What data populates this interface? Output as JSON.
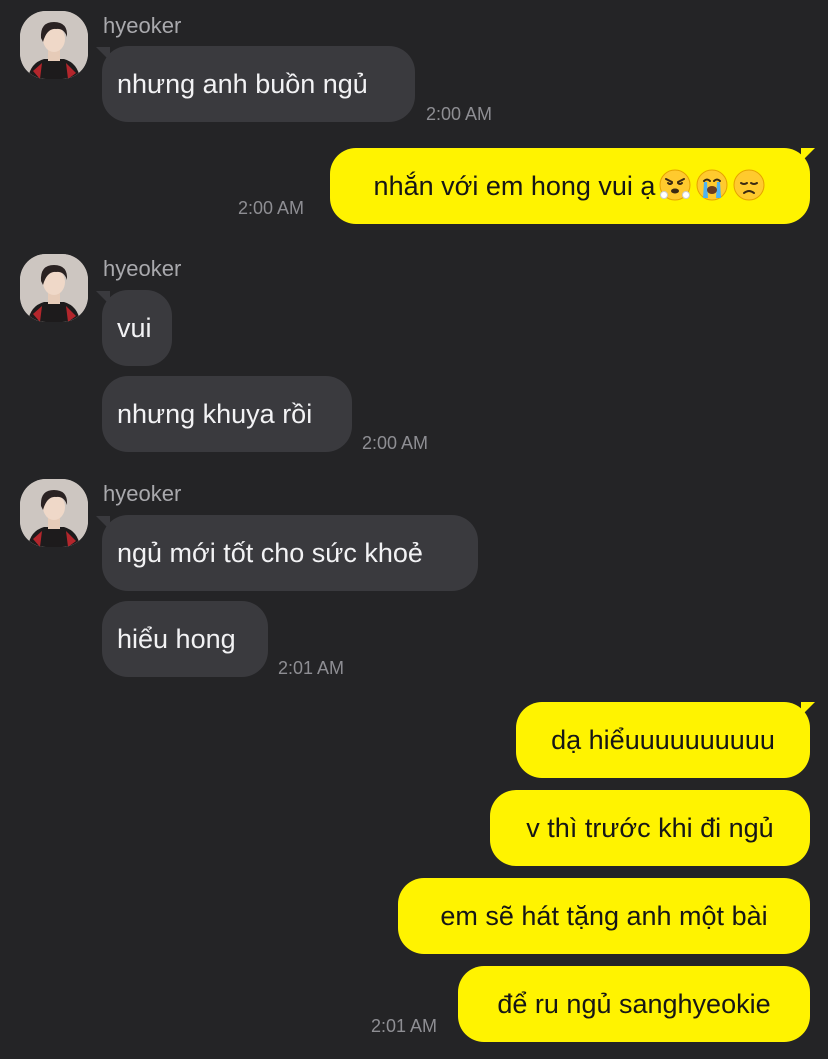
{
  "messages": [
    {
      "sender": "hyeoker",
      "text": "nhưng anh buồn ngủ",
      "time": "2:00 AM"
    },
    {
      "text": "nhắn với em hong vui ạ",
      "emojis": [
        "huffing-face-emoji",
        "crying-face-emoji",
        "disappointed-face-emoji"
      ],
      "time": "2:00 AM"
    },
    {
      "sender": "hyeoker",
      "text": "vui"
    },
    {
      "text": "nhưng khuya rồi",
      "time": "2:00 AM"
    },
    {
      "sender": "hyeoker",
      "text": "ngủ mới tốt cho sức khoẻ"
    },
    {
      "text": "hiểu hong",
      "time": "2:01 AM"
    },
    {
      "text": "dạ hiểuuuuuuuuuu"
    },
    {
      "text": "v thì trước khi đi ngủ"
    },
    {
      "text": "em sẽ hát tặng anh một bài"
    },
    {
      "text": "để ru ngủ sanghyeokie",
      "time": "2:01 AM"
    }
  ],
  "colors": {
    "background": "#242426",
    "incoming_bubble": "#3a3a3e",
    "outgoing_bubble": "#fff300",
    "timestamp": "#8e8e93",
    "sender_name": "#a9a9ad"
  }
}
